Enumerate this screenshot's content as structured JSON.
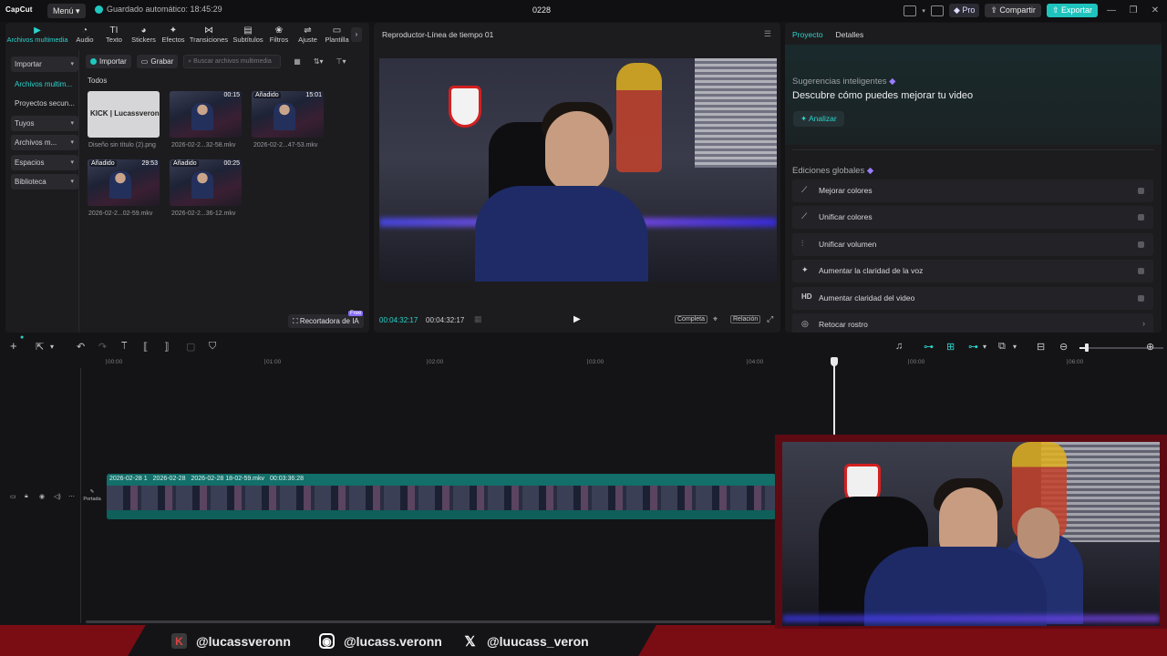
{
  "topbar": {
    "logo": "CapCut",
    "menu": "Menú",
    "autosave": "Guardado automático: 18:45:29",
    "project_title": "0228",
    "pro": "Pro",
    "share": "Compartir",
    "export": "Exportar",
    "window_controls": [
      "—",
      "❐",
      "✕"
    ]
  },
  "tool_tabs": [
    {
      "label": "Archivos multimedia",
      "icon": "media-icon",
      "glyph": "▶"
    },
    {
      "label": "Audio",
      "icon": "audio-icon",
      "glyph": "◔"
    },
    {
      "label": "Texto",
      "icon": "text-icon",
      "glyph": "TI"
    },
    {
      "label": "Stickers",
      "icon": "sticker-icon",
      "glyph": "◕"
    },
    {
      "label": "Efectos",
      "icon": "effects-icon",
      "glyph": "✦"
    },
    {
      "label": "Transiciones",
      "icon": "transitions-icon",
      "glyph": "⋈"
    },
    {
      "label": "Subtítulos",
      "icon": "subtitles-icon",
      "glyph": "▤"
    },
    {
      "label": "Filtros",
      "icon": "filters-icon",
      "glyph": "❀"
    },
    {
      "label": "Ajuste",
      "icon": "adjust-icon",
      "glyph": "⇌"
    },
    {
      "label": "Plantilla",
      "icon": "template-icon",
      "glyph": "▭"
    }
  ],
  "sidenav": [
    {
      "label": "Importar",
      "boxed": true,
      "active": false
    },
    {
      "label": "Archivos multim...",
      "boxed": false,
      "active": true
    },
    {
      "label": "Proyectos secun...",
      "boxed": false,
      "active": false
    },
    {
      "label": "Tuyos",
      "boxed": true,
      "active": false
    },
    {
      "label": "Archivos m...",
      "boxed": true,
      "active": false
    },
    {
      "label": "Espacios",
      "boxed": true,
      "active": false
    },
    {
      "label": "Biblioteca",
      "boxed": true,
      "active": false
    }
  ],
  "media": {
    "import": "Importar",
    "record": "Grabar",
    "search_placeholder": "Buscar archivos multimedia",
    "section": "Todos",
    "ai_crop": "Recortadora de IA",
    "free_tag": "Free",
    "items": [
      {
        "caption": "Diseño sin título (2).png",
        "badge": "",
        "duration": "",
        "kick_text": "KICK | Lucassveronn"
      },
      {
        "caption": "2026-02-2...32-58.mkv",
        "badge": "",
        "duration": "00:15"
      },
      {
        "caption": "2026-02-2...47-53.mkv",
        "badge": "Añadido",
        "duration": "15:01"
      },
      {
        "caption": "2026-02-2...02-59.mkv",
        "badge": "Añadido",
        "duration": "29:53"
      },
      {
        "caption": "2026-02-2...36-12.mkv",
        "badge": "Añadido",
        "duration": "00:25"
      }
    ]
  },
  "player": {
    "title": "Reproductor-Línea de tiempo 01",
    "time_current": "00:04:32:17",
    "time_total": "00:04:32:17",
    "full": "Completa",
    "ratio": "Relación"
  },
  "right_panel": {
    "tabs": [
      "Proyecto",
      "Detalles"
    ],
    "suggestions_title": "Sugerencias inteligentes",
    "suggestions_sub": "Descubre cómo puedes mejorar tu video",
    "analyze": "Analizar",
    "globals_title": "Ediciones globales",
    "globals": [
      {
        "label": "Mejorar colores",
        "icon": "magic-wand-icon",
        "glyph": "⟋"
      },
      {
        "label": "Unificar colores",
        "icon": "color-icon",
        "glyph": "⟋"
      },
      {
        "label": "Unificar volumen",
        "icon": "volume-icon",
        "glyph": "⫶"
      },
      {
        "label": "Aumentar la claridad de la voz",
        "icon": "voice-icon",
        "glyph": "✦"
      },
      {
        "label": "Aumentar claridad del video",
        "icon": "hd-icon",
        "glyph": "HD"
      },
      {
        "label": "Retocar rostro",
        "icon": "face-icon",
        "glyph": "◎"
      }
    ]
  },
  "timeline": {
    "ruler": [
      "00:00",
      "01:00",
      "02:00",
      "03:00",
      "04:00",
      "00:00",
      "06:00"
    ],
    "cover": "Portada",
    "clip_labels": [
      "2026-02-28 1",
      "2026-02-28",
      "2026-02-28 18-02-59.mkv",
      "00:03:36:28"
    ]
  },
  "banner": {
    "kick": "@lucassveronn",
    "instagram": "@lucass.veronn",
    "x": "@luucass_veron"
  },
  "colors": {
    "accent": "#2bd4cc",
    "export": "#1fc3bd",
    "banner": "#7a0c14"
  }
}
